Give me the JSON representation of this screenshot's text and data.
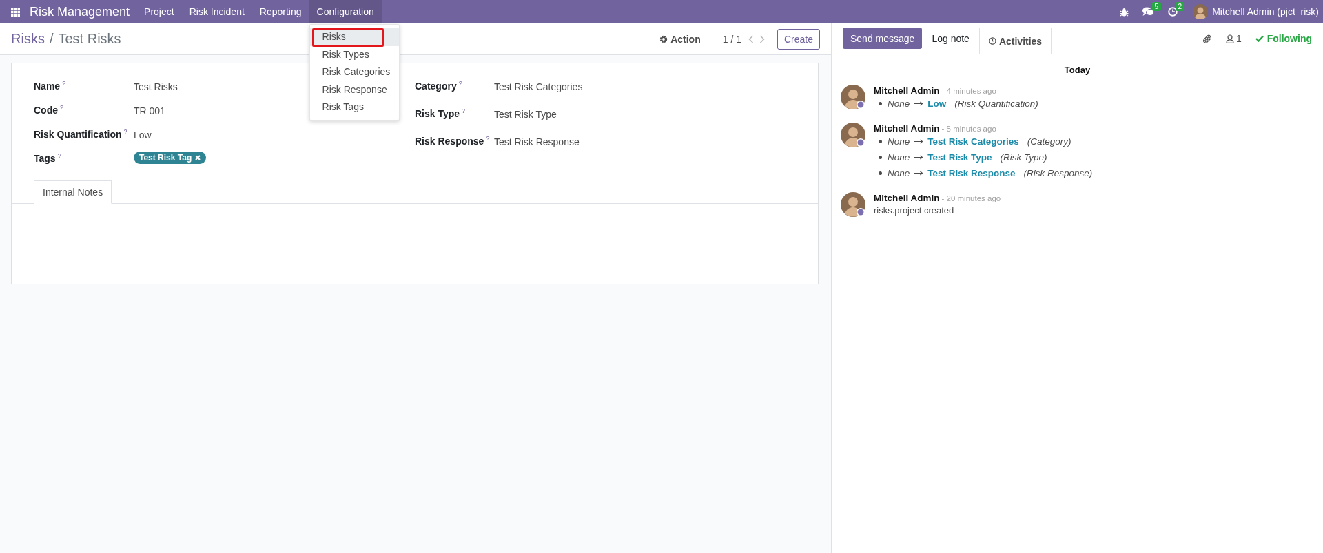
{
  "navbar": {
    "app_name": "Risk Management",
    "menus": [
      {
        "label": "Project",
        "selected": false
      },
      {
        "label": "Risk Incident",
        "selected": false
      },
      {
        "label": "Reporting",
        "selected": false
      },
      {
        "label": "Configuration",
        "selected": true
      }
    ],
    "dropdown": [
      {
        "label": "Risks",
        "selected": true
      },
      {
        "label": "Risk Types",
        "selected": false
      },
      {
        "label": "Risk Categories",
        "selected": false
      },
      {
        "label": "Risk Response",
        "selected": false
      },
      {
        "label": "Risk Tags",
        "selected": false
      }
    ],
    "messages_badge": "5",
    "activities_badge": "2",
    "user": "Mitchell Admin (pjct_risk)"
  },
  "breadcrumb": {
    "parent": "Risks",
    "separator": "/",
    "current": "Test Risks"
  },
  "control_panel": {
    "action": "Action",
    "pager": "1 / 1",
    "create": "Create"
  },
  "form": {
    "left_fields": [
      {
        "kind": "text",
        "label": "Name",
        "help": "?",
        "value": "Test Risks"
      },
      {
        "kind": "text",
        "label": "Code",
        "help": "?",
        "value": "TR 001"
      },
      {
        "kind": "text",
        "label": "Risk Quantification",
        "help": "?",
        "value": "Low"
      },
      {
        "kind": "tags",
        "label": "Tags",
        "help": "?",
        "tags": [
          "Test Risk Tag"
        ]
      }
    ],
    "right_fields": [
      {
        "kind": "text",
        "label": "Category",
        "help": "?",
        "value": "Test Risk Categories"
      },
      {
        "kind": "text",
        "label": "Risk Type",
        "help": "?",
        "value": "Test Risk Type"
      },
      {
        "kind": "text",
        "label": "Risk Response",
        "help": "?",
        "value": "Test Risk Response"
      }
    ],
    "tabs": [
      {
        "label": "Internal Notes",
        "selected": true
      }
    ]
  },
  "chatter": {
    "send_message": "Send message",
    "log_note": "Log note",
    "activities": "Activities",
    "followers": "1",
    "following": "Following",
    "date": "Today",
    "messages": [
      {
        "author": "Mitchell Admin",
        "time": "- 4 minutes ago",
        "changes": [
          {
            "old": "None",
            "new": "Low",
            "field": "(Risk Quantification)"
          }
        ]
      },
      {
        "author": "Mitchell Admin",
        "time": "- 5 minutes ago",
        "changes": [
          {
            "old": "None",
            "new": "Test Risk Categories",
            "field": "(Category)"
          },
          {
            "old": "None",
            "new": "Test Risk Type",
            "field": "(Risk Type)"
          },
          {
            "old": "None",
            "new": "Test Risk Response",
            "field": "(Risk Response)"
          }
        ]
      },
      {
        "author": "Mitchell Admin",
        "time": "- 20 minutes ago",
        "body": "risks.project created"
      }
    ]
  }
}
